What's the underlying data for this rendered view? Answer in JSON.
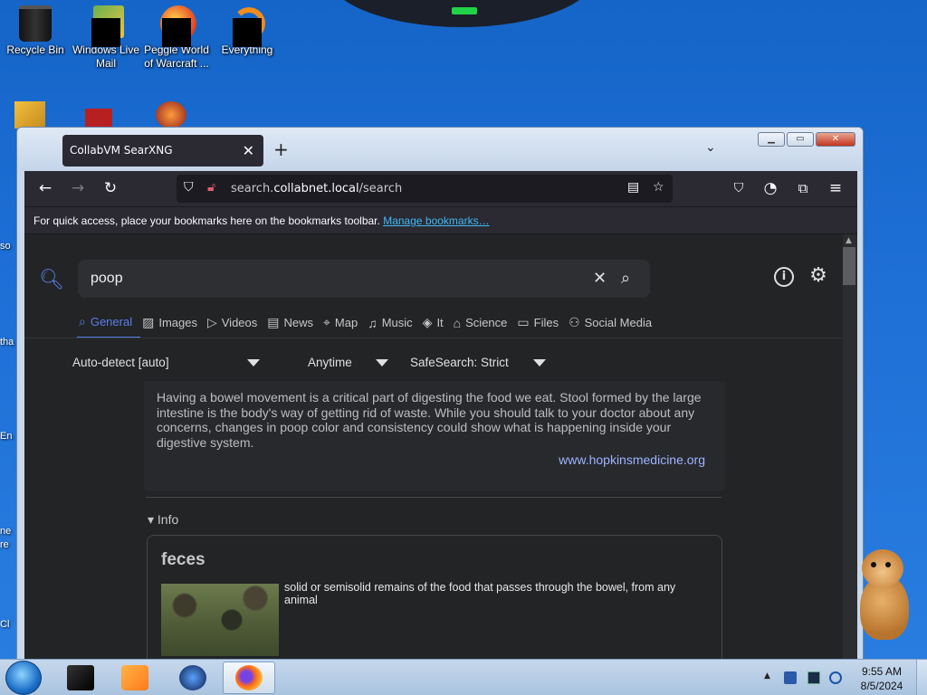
{
  "desktop": {
    "icons": [
      {
        "label": "Recycle Bin"
      },
      {
        "label": "Windows Live Mail"
      },
      {
        "label": "Peggle World of Warcraft ..."
      },
      {
        "label": "Everything"
      }
    ],
    "edge_labels": [
      "so",
      "tha",
      "En",
      "ne re",
      "Cl"
    ]
  },
  "browser": {
    "tab_title": "CollabVM SearXNG",
    "url_domain_prefix": "search.",
    "url_domain": "collabnet.local",
    "url_path": "/search",
    "bookmarks_text": "For quick access, place your bookmarks here on the bookmarks toolbar.",
    "bookmarks_link": "Manage bookmarks…"
  },
  "search": {
    "query": "poop",
    "categories": [
      {
        "label": "General",
        "icon": "search-icon",
        "active": true
      },
      {
        "label": "Images",
        "icon": "image-icon"
      },
      {
        "label": "Videos",
        "icon": "play-icon"
      },
      {
        "label": "News",
        "icon": "news-icon"
      },
      {
        "label": "Map",
        "icon": "map-pin-icon"
      },
      {
        "label": "Music",
        "icon": "music-icon"
      },
      {
        "label": "It",
        "icon": "layers-icon"
      },
      {
        "label": "Science",
        "icon": "graduation-cap-icon"
      },
      {
        "label": "Files",
        "icon": "files-icon"
      },
      {
        "label": "Social Media",
        "icon": "people-icon"
      }
    ],
    "filters": {
      "language": "Auto-detect [auto]",
      "time": "Anytime",
      "safesearch": "SafeSearch: Strict"
    },
    "answer": {
      "text": "Having a bowel movement is a critical part of digesting the food we eat. Stool formed by the large intestine is the body's way of getting rid of waste. While you should talk to your doctor about any concerns, changes in poop color and consistency could show what is happening inside your digestive system.",
      "source": "www.hopkinsmedicine.org"
    },
    "info": {
      "toggle_label": "Info",
      "title": "feces",
      "description": "solid or semisolid remains of the food that passes through the bowel, from any animal"
    }
  },
  "taskbar": {
    "time": "9:55 AM",
    "date": "8/5/2024"
  }
}
